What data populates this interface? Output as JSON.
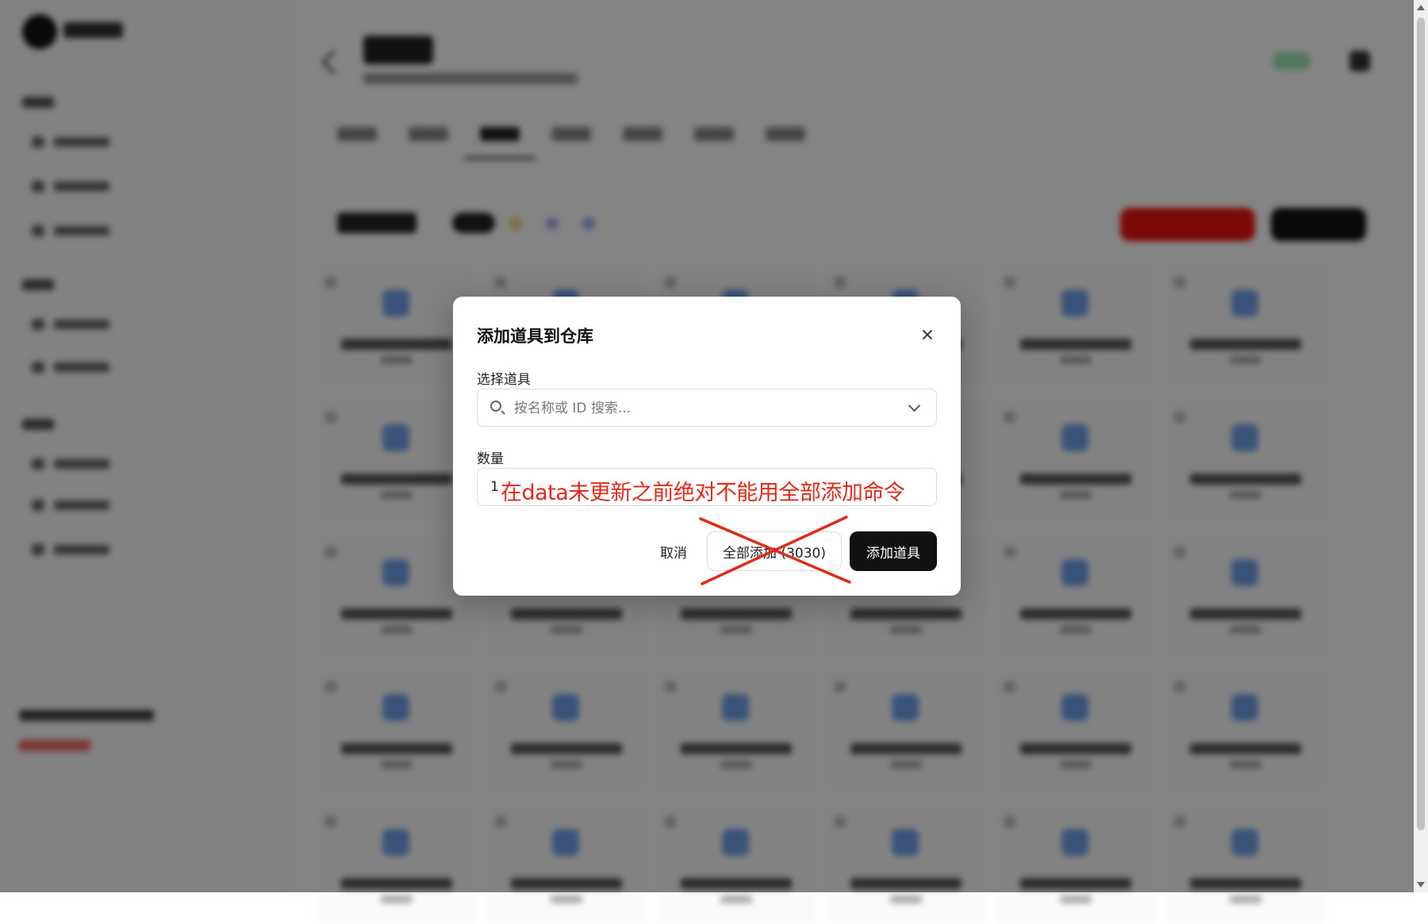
{
  "dialog": {
    "title": "添加道具到仓库",
    "select_label": "选择道具",
    "search_placeholder": "按名称或 ID 搜索...",
    "quantity_label": "数量",
    "quantity_value": "1",
    "annotation": "在data未更新之前绝对不能用全部添加命令",
    "cancel_label": "取消",
    "add_all_label": "全部添加 (3030)",
    "add_label": "添加道具"
  },
  "colors": {
    "annotation_red": "#e02a1a",
    "primary_button": "#111111",
    "overlay": "rgba(0,0,0,0.48)"
  }
}
